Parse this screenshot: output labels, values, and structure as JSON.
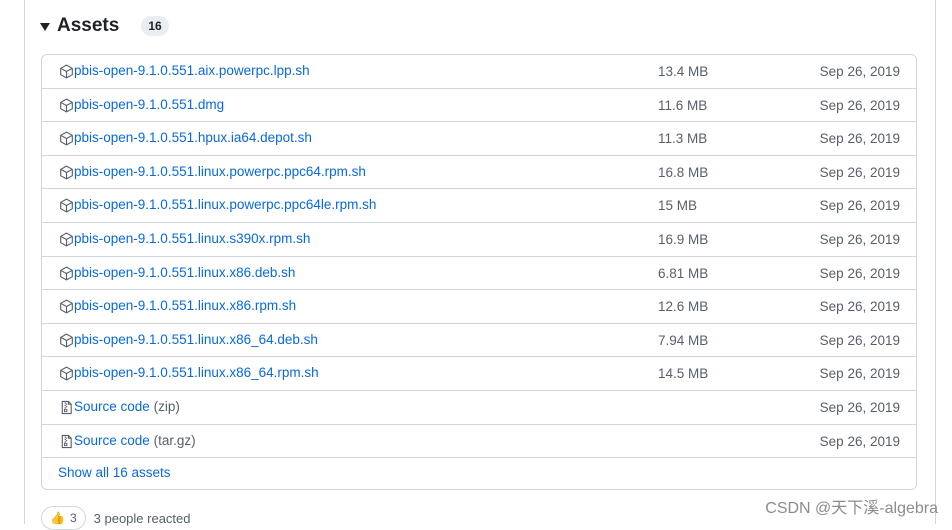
{
  "assets": {
    "title": "Assets",
    "count": "16",
    "show_all_label": "Show all 16 assets",
    "rows": [
      {
        "name": "pbis-open-9.1.0.551.aix.powerpc.lpp.sh",
        "suffix": "",
        "size": "13.4 MB",
        "date": "Sep 26, 2019",
        "icon": "package-icon"
      },
      {
        "name": "pbis-open-9.1.0.551.dmg",
        "suffix": "",
        "size": "11.6 MB",
        "date": "Sep 26, 2019",
        "icon": "package-icon"
      },
      {
        "name": "pbis-open-9.1.0.551.hpux.ia64.depot.sh",
        "suffix": "",
        "size": "11.3 MB",
        "date": "Sep 26, 2019",
        "icon": "package-icon"
      },
      {
        "name": "pbis-open-9.1.0.551.linux.powerpc.ppc64.rpm.sh",
        "suffix": "",
        "size": "16.8 MB",
        "date": "Sep 26, 2019",
        "icon": "package-icon"
      },
      {
        "name": "pbis-open-9.1.0.551.linux.powerpc.ppc64le.rpm.sh",
        "suffix": "",
        "size": "15 MB",
        "date": "Sep 26, 2019",
        "icon": "package-icon"
      },
      {
        "name": "pbis-open-9.1.0.551.linux.s390x.rpm.sh",
        "suffix": "",
        "size": "16.9 MB",
        "date": "Sep 26, 2019",
        "icon": "package-icon"
      },
      {
        "name": "pbis-open-9.1.0.551.linux.x86.deb.sh",
        "suffix": "",
        "size": "6.81 MB",
        "date": "Sep 26, 2019",
        "icon": "package-icon"
      },
      {
        "name": "pbis-open-9.1.0.551.linux.x86.rpm.sh",
        "suffix": "",
        "size": "12.6 MB",
        "date": "Sep 26, 2019",
        "icon": "package-icon"
      },
      {
        "name": "pbis-open-9.1.0.551.linux.x86_64.deb.sh",
        "suffix": "",
        "size": "7.94 MB",
        "date": "Sep 26, 2019",
        "icon": "package-icon"
      },
      {
        "name": "pbis-open-9.1.0.551.linux.x86_64.rpm.sh",
        "suffix": "",
        "size": "14.5 MB",
        "date": "Sep 26, 2019",
        "icon": "package-icon"
      },
      {
        "name": "Source code",
        "suffix": "(zip)",
        "size": "",
        "date": "Sep 26, 2019",
        "icon": "zip-file-icon"
      },
      {
        "name": "Source code",
        "suffix": "(tar.gz)",
        "size": "",
        "date": "Sep 26, 2019",
        "icon": "zip-file-icon"
      }
    ]
  },
  "reactions": {
    "emoji": "👍",
    "count": "3",
    "text": "3 people reacted"
  },
  "watermark": "CSDN @天下溪-algebra",
  "colors": {
    "link": "#0969da",
    "muted": "#57606a",
    "border": "#d0d7de"
  }
}
